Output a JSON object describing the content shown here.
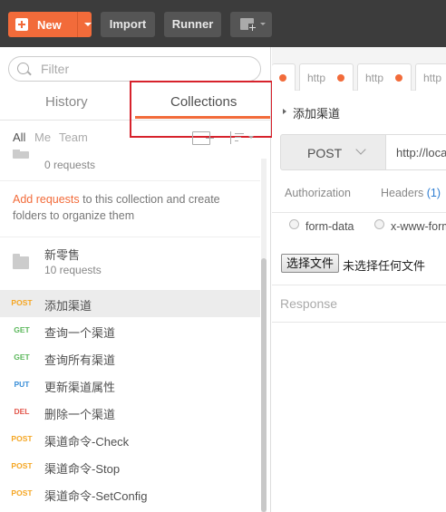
{
  "toolbar": {
    "new_label": "New",
    "import_label": "Import",
    "runner_label": "Runner"
  },
  "sidebar": {
    "search_placeholder": "Filter",
    "tabs": {
      "history": "History",
      "collections": "Collections"
    },
    "filters": {
      "all": "All",
      "me": "Me",
      "team": "Team"
    },
    "collections": [
      {
        "name": "",
        "request_count": "0 requests"
      },
      {
        "name": "新零售",
        "request_count": "10 requests"
      }
    ],
    "info": {
      "link": "Add requests",
      "text": " to this collection and create folders to organize them"
    },
    "requests": [
      {
        "method": "POST",
        "name": "添加渠道"
      },
      {
        "method": "GET",
        "name": "查询一个渠道"
      },
      {
        "method": "GET",
        "name": "查询所有渠道"
      },
      {
        "method": "PUT",
        "name": "更新渠道属性"
      },
      {
        "method": "DEL",
        "name": "删除一个渠道"
      },
      {
        "method": "POST",
        "name": "渠道命令-Check"
      },
      {
        "method": "POST",
        "name": "渠道命令-Stop"
      },
      {
        "method": "POST",
        "name": "渠道命令-SetConfig"
      }
    ]
  },
  "main": {
    "open_tabs": [
      "http",
      "http",
      "http"
    ],
    "request_title": "添加渠道",
    "method": "POST",
    "url": "http://loca",
    "subtabs": {
      "authorization": "Authorization",
      "headers": "Headers",
      "headers_count": "(1)"
    },
    "body_modes": {
      "form_data": "form-data",
      "urlencoded": "x-www-form"
    },
    "file_button": "选择文件",
    "file_status": "未选择任何文件",
    "response_label": "Response"
  },
  "colors": {
    "accent": "#f26b3a",
    "post": "#f5a623",
    "get": "#5cb85c",
    "put": "#3a8fd8",
    "del": "#e3584d",
    "highlight_box": "#d7222c"
  }
}
